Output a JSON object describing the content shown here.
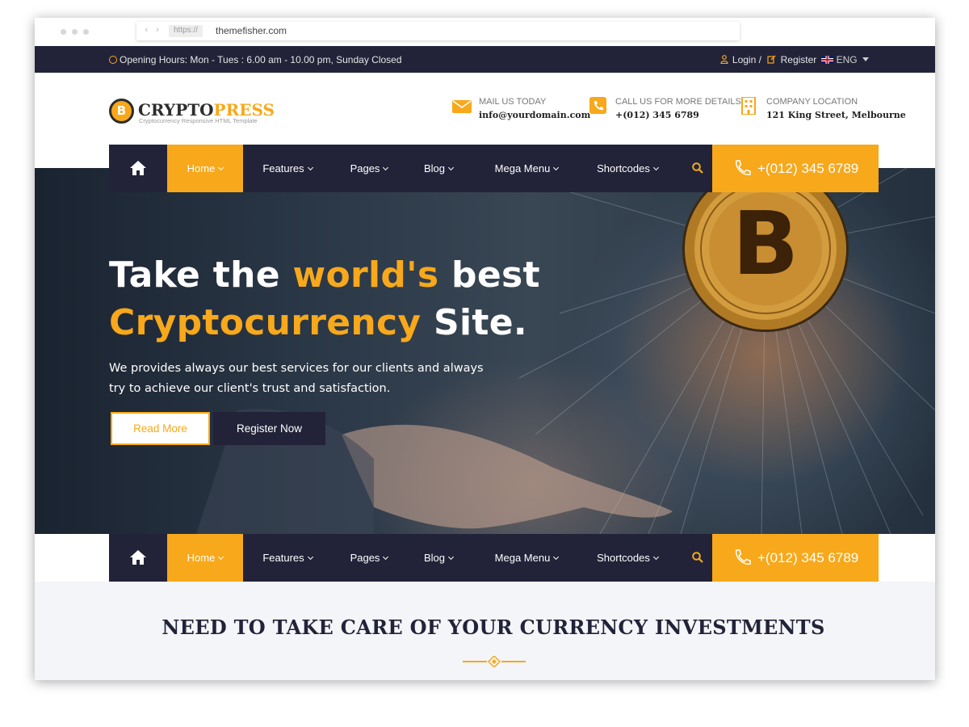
{
  "browser": {
    "nav_arrows": "‹ ›",
    "protocol": "https://",
    "domain": "themefisher.com"
  },
  "topbar": {
    "hours": "Opening Hours: Mon - Tues : 6.00 am - 10.00 pm, Sunday Closed",
    "login": "Login /",
    "register": "Register",
    "language": "ENG"
  },
  "header": {
    "logo_coin": "B",
    "logo_part1": "CRYPTO",
    "logo_part2": "PRESS",
    "logo_tagline": "Cryptocurrency Responsive HTML Template",
    "mail_label": "MAIL US TODAY",
    "mail_value": "info@yourdomain.com",
    "call_label": "CALL US FOR MORE DETAILS",
    "call_value": "+(012) 345 6789",
    "location_label": "COMPANY LOCATION",
    "location_value": "121 King Street, Melbourne"
  },
  "nav": {
    "items": [
      "Home",
      "Features",
      "Pages",
      "Blog",
      "Mega Menu",
      "Shortcodes"
    ],
    "phone": "+(012) 345 6789"
  },
  "hero": {
    "title_1": "Take the ",
    "title_highlight_1": "world's",
    "title_2": " best",
    "title_highlight_2": "Cryptocurrency",
    "title_3": " Site.",
    "text": "We provides always our best services for our clients and always try to achieve our client's trust and satisfaction.",
    "read_more": "Read More",
    "register_now": "Register Now",
    "coin_symbol": "B"
  },
  "section": {
    "title": "NEED TO TAKE CARE OF YOUR CURRENCY INVESTMENTS"
  },
  "colors": {
    "accent": "#f7a81b",
    "navy": "#222339"
  }
}
